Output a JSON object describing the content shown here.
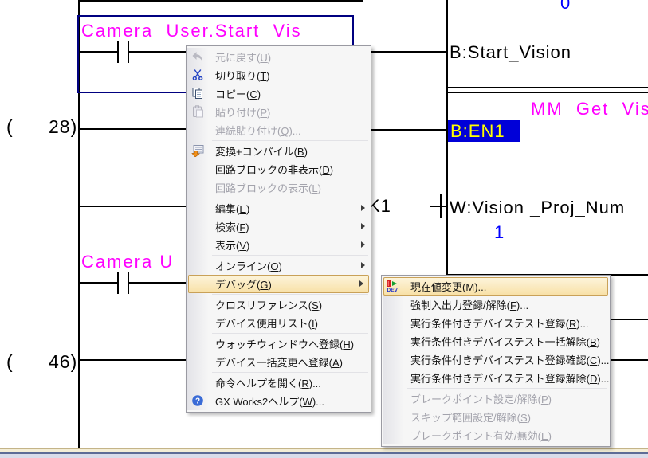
{
  "ladder": {
    "camera_contact_1": "Camera  User.Start  Vis",
    "camera_contact_2": "Camera U",
    "coil_start_vision": "B:Start_Vision",
    "monitor_value_top": "0",
    "block_title": "MM  Get  Vis",
    "block_input_en1": "B:EN1",
    "operand_k1": "K1",
    "word_device": "W:Vision _Proj_Num",
    "word_value": "1",
    "rung_28": "(      28)",
    "rung_46": "(      46)",
    "colors": {
      "comment_magenta": "#ff00ff",
      "monitor_blue": "#0000ff",
      "selection_navy": "#000080",
      "en1_background": "#0000d8",
      "en1_text": "#ffff00"
    }
  },
  "context_menu": {
    "items": [
      {
        "label": "元に戻す(U)",
        "icon": "undo-icon",
        "enabled": false
      },
      {
        "label": "切り取り(T)",
        "icon": "cut-icon",
        "enabled": true
      },
      {
        "label": "コピー(C)",
        "icon": "copy-icon",
        "enabled": true
      },
      {
        "label": "貼り付け(P)",
        "icon": "paste-icon",
        "enabled": false
      },
      {
        "label": "連続貼り付け(Q)...",
        "enabled": false
      },
      {
        "separator": true
      },
      {
        "label": "変換+コンパイル(B)",
        "icon": "convert-compile-icon",
        "enabled": true
      },
      {
        "label": "回路ブロックの非表示(D)",
        "enabled": true
      },
      {
        "label": "回路ブロックの表示(L)",
        "enabled": false
      },
      {
        "separator": true
      },
      {
        "label": "編集(E)",
        "enabled": true,
        "submenu": true
      },
      {
        "label": "検索(F)",
        "enabled": true,
        "submenu": true
      },
      {
        "label": "表示(V)",
        "enabled": true,
        "submenu": true
      },
      {
        "separator": true
      },
      {
        "label": "オンライン(O)",
        "enabled": true,
        "submenu": true
      },
      {
        "label": "デバッグ(G)",
        "enabled": true,
        "submenu": true,
        "highlighted": true
      },
      {
        "separator": true
      },
      {
        "label": "クロスリファレンス(S)",
        "enabled": true
      },
      {
        "label": "デバイス使用リスト(I)",
        "enabled": true
      },
      {
        "separator": true
      },
      {
        "label": "ウォッチウィンドウへ登録(H)",
        "enabled": true
      },
      {
        "label": "デバイス一括変更へ登録(A)",
        "enabled": true
      },
      {
        "separator": true
      },
      {
        "label": "命令ヘルプを開く(R)...",
        "enabled": true
      },
      {
        "label": "GX Works2ヘルプ(W)...",
        "icon": "help-icon",
        "enabled": true
      }
    ]
  },
  "debug_submenu": {
    "items": [
      {
        "label": "現在値変更(M)...",
        "icon": "device-value-icon",
        "enabled": true,
        "highlighted": true
      },
      {
        "label": "強制入出力登録/解除(F)...",
        "enabled": true
      },
      {
        "label": "実行条件付きデバイステスト登録(R)...",
        "enabled": true
      },
      {
        "label": "実行条件付きデバイステスト一括解除(B)",
        "enabled": true
      },
      {
        "label": "実行条件付きデバイステスト登録確認(C)...",
        "enabled": true
      },
      {
        "label": "実行条件付きデバイステスト登録解除(D)...",
        "enabled": true
      },
      {
        "separator": true
      },
      {
        "label": "ブレークポイント設定/解除(P)",
        "enabled": false
      },
      {
        "label": "スキップ範囲設定/解除(S)",
        "enabled": false
      },
      {
        "label": "ブレークポイント有効/無効(E)",
        "enabled": false
      }
    ]
  }
}
